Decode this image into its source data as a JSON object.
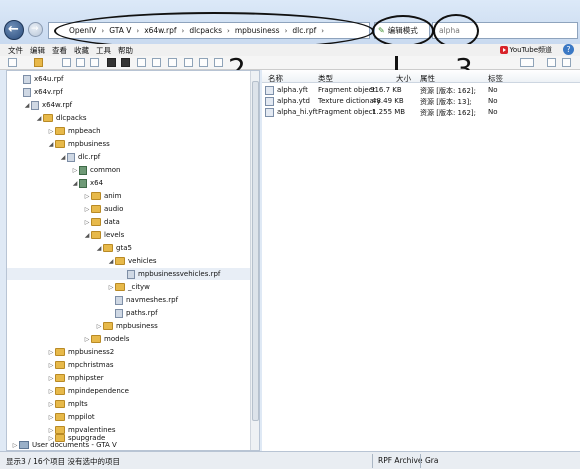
{
  "address": {
    "crumbs": [
      "OpenIV",
      "GTA V",
      "x64w.rpf",
      "dlcpacks",
      "mpbusiness",
      "dlc.rpf"
    ],
    "mode_label": "编辑模式",
    "search_value": "alpha"
  },
  "menu": [
    "文件",
    "编辑",
    "查看",
    "收藏",
    "工具",
    "帮助"
  ],
  "youtube_label": "YouTube频道",
  "help_label": "?",
  "annotations": [
    "2",
    "3"
  ],
  "tree": [
    {
      "label": "x64u.rpf",
      "icon": "rpf"
    },
    {
      "label": "x64v.rpf",
      "icon": "rpf"
    },
    {
      "label": "x64w.rpf",
      "icon": "rpf"
    },
    {
      "label": "dlcpacks",
      "icon": "folder"
    },
    {
      "label": "mpbeach",
      "icon": "folder"
    },
    {
      "label": "mpbusiness",
      "icon": "folder"
    },
    {
      "label": "dlc.rpf",
      "icon": "rpf"
    },
    {
      "label": "common",
      "icon": "grn"
    },
    {
      "label": "x64",
      "icon": "grn"
    },
    {
      "label": "anim",
      "icon": "folder"
    },
    {
      "label": "audio",
      "icon": "folder"
    },
    {
      "label": "data",
      "icon": "folder"
    },
    {
      "label": "levels",
      "icon": "folder"
    },
    {
      "label": "gta5",
      "icon": "folder"
    },
    {
      "label": "vehicles",
      "icon": "folder"
    },
    {
      "label": "mpbusinessvehicles.rpf",
      "icon": "rpf"
    },
    {
      "label": "_cityw",
      "icon": "folder"
    },
    {
      "label": "navmeshes.rpf",
      "icon": "rpf"
    },
    {
      "label": "paths.rpf",
      "icon": "rpf"
    },
    {
      "label": "mpbusiness",
      "icon": "folder"
    },
    {
      "label": "models",
      "icon": "folder"
    },
    {
      "label": "mpbusiness2",
      "icon": "folder"
    },
    {
      "label": "mpchristmas",
      "icon": "folder"
    },
    {
      "label": "mphipster",
      "icon": "folder"
    },
    {
      "label": "mpindependence",
      "icon": "folder"
    },
    {
      "label": "mplts",
      "icon": "folder"
    },
    {
      "label": "mppilot",
      "icon": "folder"
    },
    {
      "label": "mpvalentines",
      "icon": "folder"
    },
    {
      "label": "spupgrade",
      "icon": "folder"
    },
    {
      "label": "User documents - GTA V",
      "icon": "drive"
    }
  ],
  "list": {
    "headers": [
      "名称",
      "类型",
      "大小",
      "属性",
      "标签"
    ],
    "rows": [
      {
        "name": "alpha.yft",
        "type": "Fragment object",
        "size": "916.7 KB",
        "attr": "资源 [版本: 162];",
        "tag": "No"
      },
      {
        "name": "alpha.ytd",
        "type": "Texture dictionary",
        "size": "48.49 KB",
        "attr": "资源 [版本: 13];",
        "tag": "No"
      },
      {
        "name": "alpha_hi.yft",
        "type": "Fragment object",
        "size": "1.255 MB",
        "attr": "资源 [版本: 162];",
        "tag": "No"
      }
    ]
  },
  "status": {
    "text": "显示3 / 16个项目 没有选中的项目",
    "archive_type": "RPF Archive",
    "extra": "Gra"
  }
}
